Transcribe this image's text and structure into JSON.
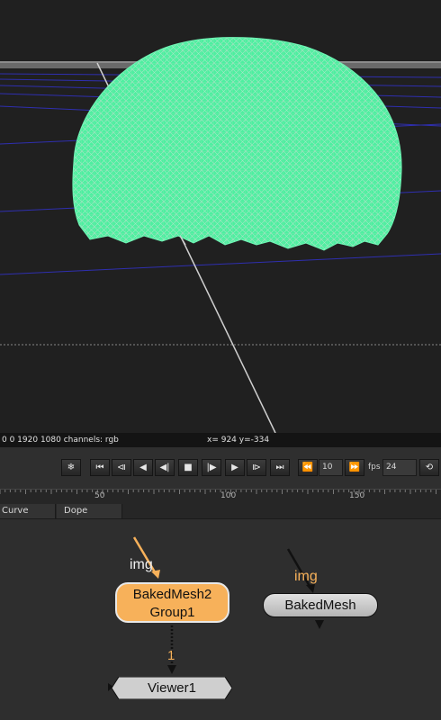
{
  "viewer": {
    "info_format": "0 0 1920 1080 channels: rgb",
    "info_coords": "x= 924 y=-334",
    "mesh_color": "#4df0a0",
    "bg_color": "#202020"
  },
  "transport": {
    "buttons": [
      {
        "name": "freeze-icon",
        "glyph": "❄"
      },
      {
        "name": "goto-start-icon",
        "glyph": "⏮"
      },
      {
        "name": "prev-keyframe-icon",
        "glyph": "⧏"
      },
      {
        "name": "step-back-icon",
        "glyph": "◀"
      },
      {
        "name": "play-backward-icon",
        "glyph": "◀|"
      },
      {
        "name": "stop-icon",
        "glyph": "■"
      },
      {
        "name": "play-forward-icon",
        "glyph": "|▶"
      },
      {
        "name": "step-forward-icon",
        "glyph": "▶"
      },
      {
        "name": "next-keyframe-icon",
        "glyph": "⧐"
      },
      {
        "name": "goto-end-icon",
        "glyph": "⏭"
      }
    ],
    "skip_back_glyph": "⏪",
    "skip_forward_glyph": "⏩",
    "increment": "10",
    "fps_label": "fps",
    "fps_value": "24",
    "loop_glyph": "⟲"
  },
  "timeline": {
    "ticks": [
      "50",
      "100",
      "150"
    ]
  },
  "tabs": [
    "Curve Editor",
    "Dope Sheet"
  ],
  "nodes": {
    "baked2": {
      "line1": "BakedMesh2",
      "line2": "Group1",
      "input_label": "img",
      "color": "#f7b15a"
    },
    "baked": {
      "line1": "BakedMesh",
      "input_label": "img",
      "color": "#d0d0d0"
    },
    "viewer": {
      "line1": "Viewer1",
      "input_label": "1"
    }
  }
}
